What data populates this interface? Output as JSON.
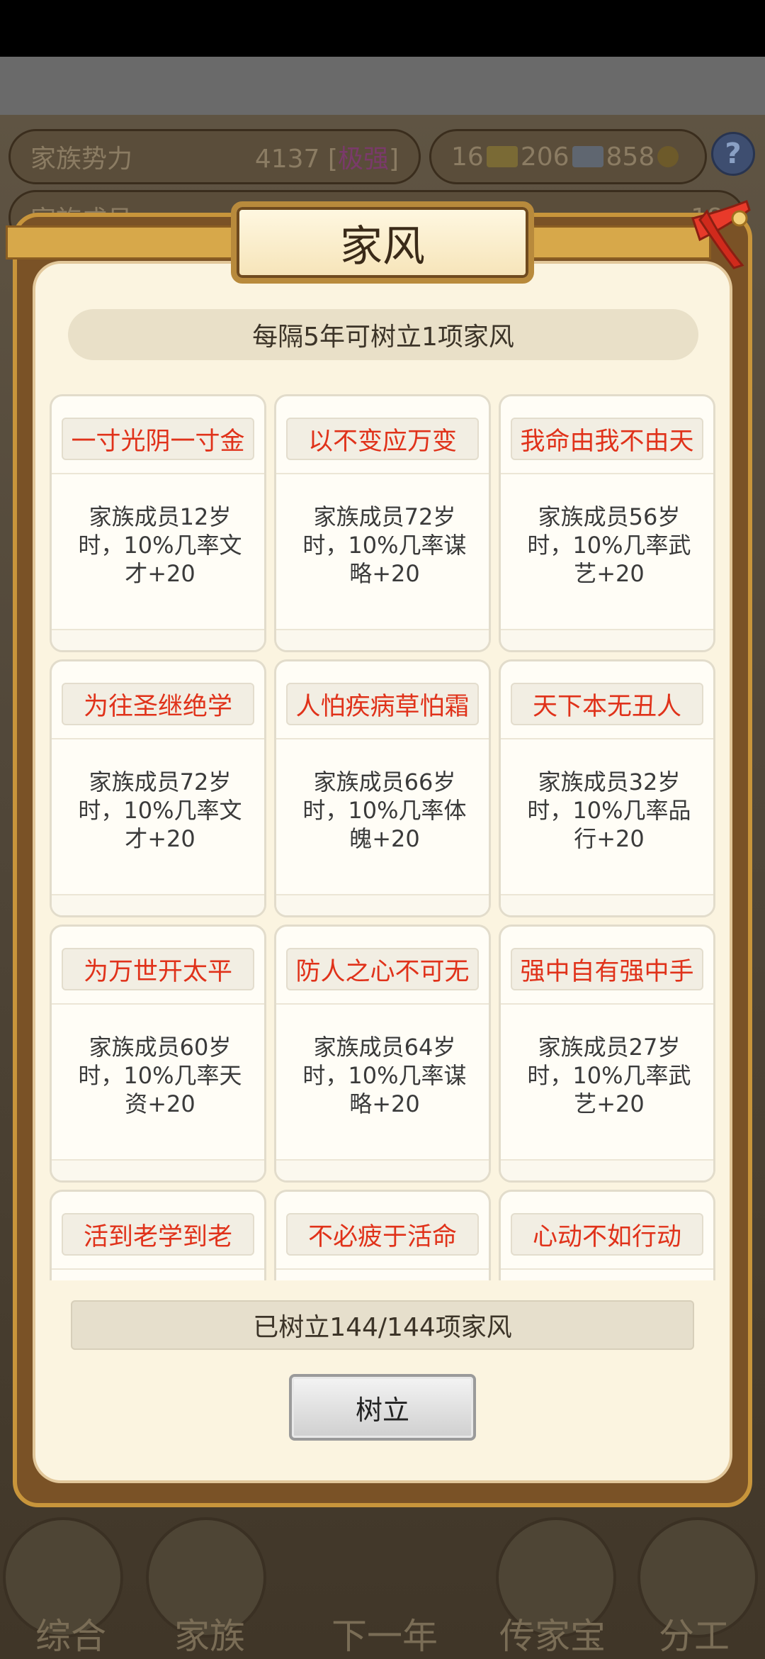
{
  "background": {
    "row1": {
      "label": "家族势力",
      "value": "4137 [",
      "rank": "极强",
      "value_end": "]"
    },
    "resources": {
      "gold": "16",
      "silver": "206",
      "coins": "858"
    },
    "row2": {
      "label": "家族成员",
      "value": "18"
    },
    "help_label": "?",
    "nav": [
      "综合",
      "家族",
      "下一年",
      "传家宝",
      "分工"
    ]
  },
  "modal": {
    "title": "家风",
    "notice": "每隔5年可树立1项家风",
    "mottos": [
      {
        "name": "一寸光阴一寸金",
        "desc": "家族成员12岁时，10%几率文才+20"
      },
      {
        "name": "以不变应万变",
        "desc": "家族成员72岁时，10%几率谋略+20"
      },
      {
        "name": "我命由我不由天",
        "desc": "家族成员56岁时，10%几率武艺+20"
      },
      {
        "name": "为往圣继绝学",
        "desc": "家族成员72岁时，10%几率文才+20"
      },
      {
        "name": "人怕疾病草怕霜",
        "desc": "家族成员66岁时，10%几率体魄+20"
      },
      {
        "name": "天下本无丑人",
        "desc": "家族成员32岁时，10%几率品行+20"
      },
      {
        "name": "为万世开太平",
        "desc": "家族成员60岁时，10%几率天资+20"
      },
      {
        "name": "防人之心不可无",
        "desc": "家族成员64岁时，10%几率谋略+20"
      },
      {
        "name": "强中自有强中手",
        "desc": "家族成员27岁时，10%几率武艺+20"
      },
      {
        "name": "活到老学到老",
        "desc": ""
      },
      {
        "name": "不必疲于活命",
        "desc": ""
      },
      {
        "name": "心动不如行动",
        "desc": ""
      }
    ],
    "count_text": "已树立144/144项家风",
    "establish_label": "树立"
  }
}
